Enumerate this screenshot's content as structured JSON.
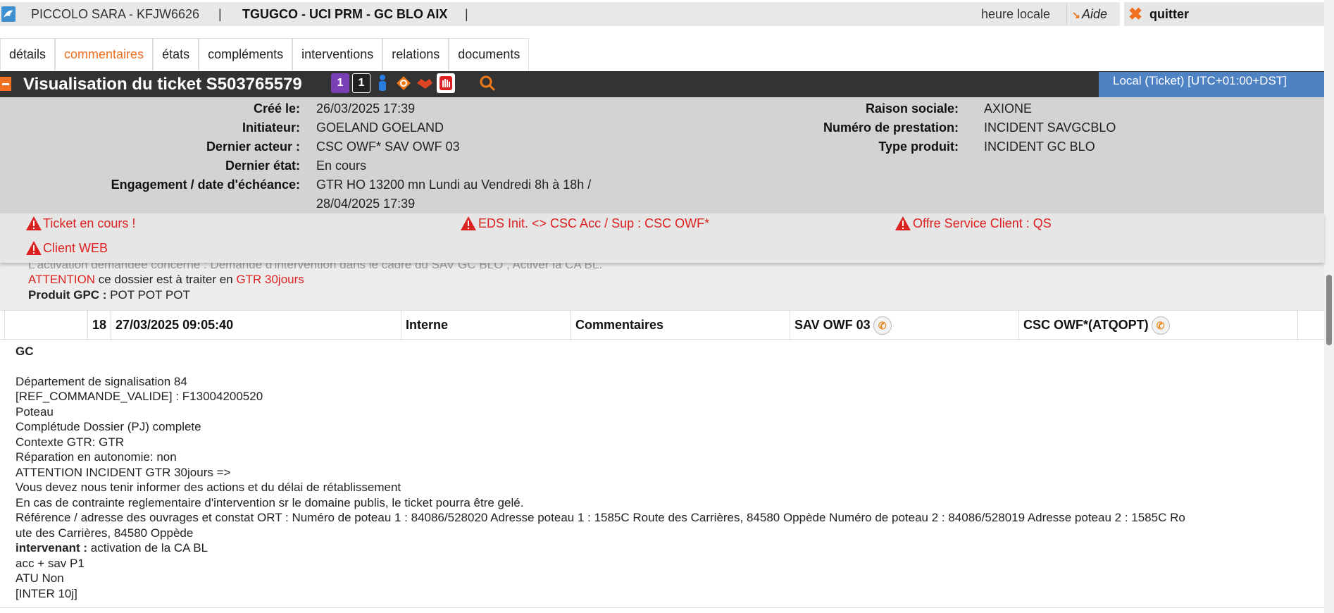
{
  "header": {
    "user": "PICCOLO SARA - KFJW6626",
    "separator": "|",
    "context": "TGUGCO - UCI PRM - GC BLO AIX",
    "local_time_label": "heure locale",
    "help_label": "Aide",
    "quit_label": "quitter"
  },
  "tabs": [
    {
      "label": "détails",
      "active": false
    },
    {
      "label": "commentaires",
      "active": true
    },
    {
      "label": "états",
      "active": false
    },
    {
      "label": "compléments",
      "active": false
    },
    {
      "label": "interventions",
      "active": false
    },
    {
      "label": "relations",
      "active": false
    },
    {
      "label": "documents",
      "active": false
    }
  ],
  "ticket": {
    "title": "Visualisation du ticket  S503765579",
    "timezone": "Local (Ticket) [UTC+01:00+DST]",
    "status_icons": [
      "priority-1-icon",
      "escalation-1-icon",
      "person-icon",
      "status-diamond-icon",
      "handshake-icon",
      "stop-hand-icon"
    ],
    "badge_1": "1",
    "badge_2": "1"
  },
  "info_left": [
    {
      "label": "Créé le:",
      "value": "26/03/2025 17:39"
    },
    {
      "label": "Initiateur:",
      "value": "GOELAND GOELAND"
    },
    {
      "label": "Dernier acteur :",
      "value": "CSC OWF* SAV OWF 03"
    },
    {
      "label": "Dernier état:",
      "value": "En cours"
    },
    {
      "label": "Engagement / date d'échéance:",
      "value": "GTR HO 13200 mn Lundi au Vendredi 8h à 18h /",
      "value2": "28/04/2025 17:39"
    }
  ],
  "info_right": [
    {
      "label": "Raison sociale:",
      "value": "AXIONE"
    },
    {
      "label": "Numéro de prestation:",
      "value": "INCIDENT SAVGCBLO"
    },
    {
      "label": "Type produit:",
      "value": "INCIDENT GC BLO"
    }
  ],
  "alerts": [
    "Ticket en cours !",
    "EDS Init. <> CSC Acc / Sup : CSC OWF*",
    "Offre Service Client : QS",
    "Client WEB"
  ],
  "behind": {
    "partial_line": "L'activation demandée concerne : Demande d'intervention dans le cadre du SAV GC BLO , Activer la CA BL.",
    "attention": "ATTENTION",
    "attention_text": " ce dossier est à traiter en ",
    "gtr": "GTR 30jours",
    "produit_label": "Produit GPC :",
    "produit_value": " POT POT POT"
  },
  "row": {
    "number": "18",
    "date": "27/03/2025 09:05:40",
    "type": "Interne",
    "category": "Commentaires",
    "actor": "SAV OWF 03",
    "team": "CSC OWF*(ATQOPT)"
  },
  "comment": {
    "title": "GC",
    "lines": [
      "Département de signalisation 84",
      "[REF_COMMANDE_VALIDE] : F13004200520",
      "Poteau",
      "Complétude Dossier (PJ) complete",
      "Contexte GTR: GTR",
      "Réparation en autonomie: non",
      "ATTENTION INCIDENT GTR 30jours =>",
      "Vous devez nous tenir informer des actions et du délai de rétablissement",
      "En cas de contrainte reglementaire d'intervention sr le domaine publis, le ticket pourra être gelé.",
      "Référence / adresse des ouvrages et constat ORT : Numéro de poteau 1 : 84086/528020 Adresse poteau 1 : 1585C Route des Carrières, 84580 Oppède Numéro de poteau 2 : 84086/528019 Adresse poteau 2 : 1585C Ro",
      "ute des Carrières, 84580 Oppède"
    ],
    "intervenant_label": "intervenant :",
    "intervenant_value": " activation de la CA BL",
    "tail_lines": [
      "acc + sav P1",
      "ATU Non",
      "[INTER 10j]"
    ]
  }
}
